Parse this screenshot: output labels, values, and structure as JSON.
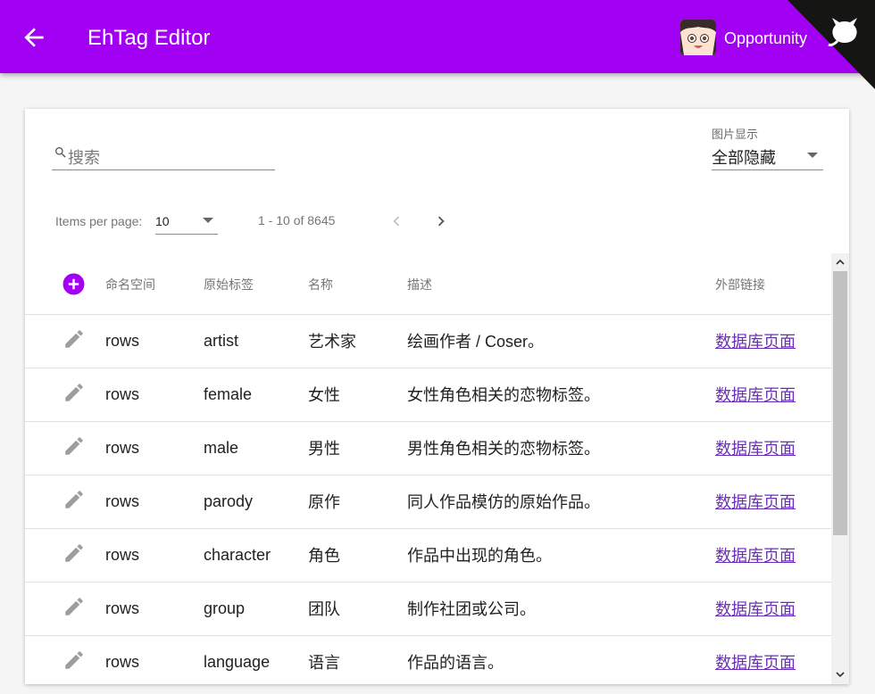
{
  "header": {
    "title": "EhTag Editor",
    "user_name": "Opportunity",
    "bg_color": "#a100f2"
  },
  "search": {
    "placeholder": "搜索"
  },
  "image_display": {
    "label": "图片显示",
    "value": "全部隐藏"
  },
  "pagination": {
    "items_per_page_label": "Items per page:",
    "items_per_page": "10",
    "range": "1 - 10 of 8645"
  },
  "table": {
    "columns": [
      "命名空间",
      "原始标签",
      "名称",
      "描述",
      "外部链接"
    ],
    "rows": [
      {
        "namespace": "rows",
        "raw": "artist",
        "name": "艺术家",
        "desc": "绘画作者 / Coser。",
        "link": "数据库页面"
      },
      {
        "namespace": "rows",
        "raw": "female",
        "name": "女性",
        "desc": "女性角色相关的恋物标签。",
        "link": "数据库页面"
      },
      {
        "namespace": "rows",
        "raw": "male",
        "name": "男性",
        "desc": "男性角色相关的恋物标签。",
        "link": "数据库页面"
      },
      {
        "namespace": "rows",
        "raw": "parody",
        "name": "原作",
        "desc": "同人作品模仿的原始作品。",
        "link": "数据库页面"
      },
      {
        "namespace": "rows",
        "raw": "character",
        "name": "角色",
        "desc": "作品中出现的角色。",
        "link": "数据库页面"
      },
      {
        "namespace": "rows",
        "raw": "group",
        "name": "团队",
        "desc": "制作社团或公司。",
        "link": "数据库页面"
      },
      {
        "namespace": "rows",
        "raw": "language",
        "name": "语言",
        "desc": "作品的语言。",
        "link": "数据库页面"
      }
    ]
  }
}
